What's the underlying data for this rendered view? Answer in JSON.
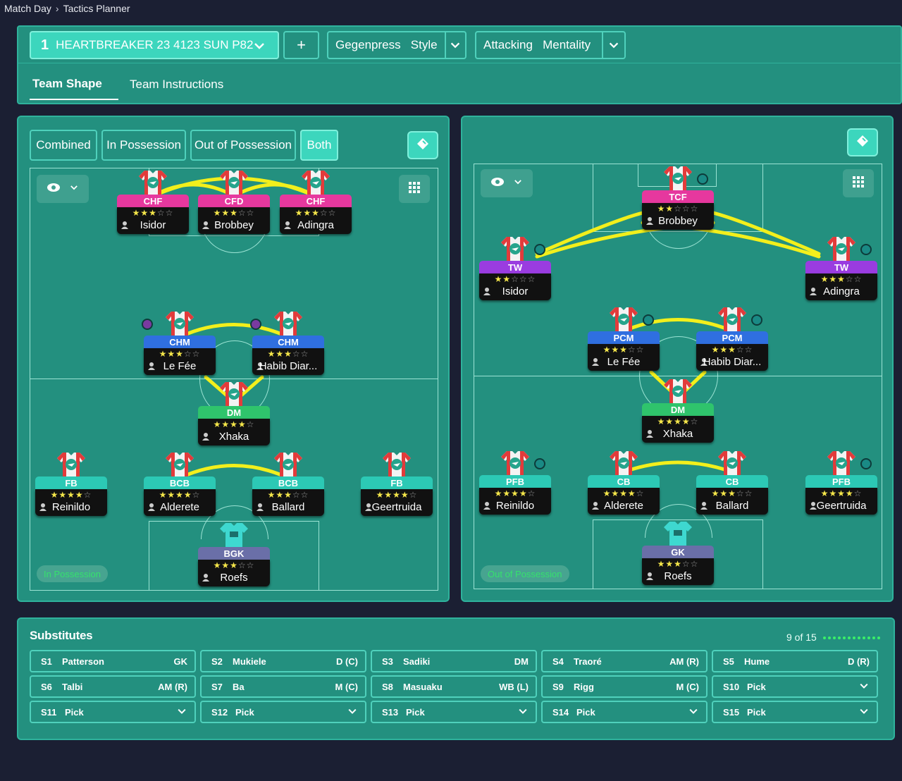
{
  "breadcrumb": {
    "root": "Match Day",
    "current": "Tactics Planner"
  },
  "tactic": {
    "number": "1",
    "name": "HEARTBREAKER 23 4123 SUN P82"
  },
  "style": {
    "value": "Gegenpress",
    "label": "Style"
  },
  "mentality": {
    "value": "Attacking",
    "label": "Mentality"
  },
  "tabs": [
    "Team Shape",
    "Team Instructions"
  ],
  "phase_filters": [
    "Combined",
    "In Possession",
    "Out of Possession",
    "Both"
  ],
  "left_pitch": {
    "label": "In Possession",
    "players": [
      {
        "role": "CHF",
        "name": "Isidor",
        "stars": 2.5,
        "color": "#e6389e"
      },
      {
        "role": "CFD",
        "name": "Brobbey",
        "stars": 2.5,
        "color": "#e6389e"
      },
      {
        "role": "CHF",
        "name": "Adingra",
        "stars": 3,
        "color": "#e6389e"
      },
      {
        "role": "CHM",
        "name": "Le Fée",
        "stars": 3,
        "color": "#2f6fe0"
      },
      {
        "role": "CHM",
        "name": "Habib Diar...",
        "stars": 2.5,
        "color": "#2f6fe0"
      },
      {
        "role": "DM",
        "name": "Xhaka",
        "stars": 4,
        "color": "#2fc46c"
      },
      {
        "role": "FB",
        "name": "Reinildo",
        "stars": 3.5,
        "color": "#2cc9b5"
      },
      {
        "role": "BCB",
        "name": "Alderete",
        "stars": 3.5,
        "color": "#2cc9b5"
      },
      {
        "role": "BCB",
        "name": "Ballard",
        "stars": 3,
        "color": "#2cc9b5"
      },
      {
        "role": "FB",
        "name": "Geertruida",
        "stars": 3.5,
        "color": "#2cc9b5"
      },
      {
        "role": "BGK",
        "name": "Roefs",
        "stars": 2.5,
        "color": "#6a6fa8"
      }
    ]
  },
  "right_pitch": {
    "label": "Out of Possession",
    "players": [
      {
        "role": "TCF",
        "name": "Brobbey",
        "stars": 2,
        "color": "#e6389e"
      },
      {
        "role": "TW",
        "name": "Isidor",
        "stars": 2,
        "color": "#9a3ce0"
      },
      {
        "role": "TW",
        "name": "Adingra",
        "stars": 2.5,
        "color": "#9a3ce0"
      },
      {
        "role": "PCM",
        "name": "Le Fée",
        "stars": 2.5,
        "color": "#2f6fe0"
      },
      {
        "role": "PCM",
        "name": "Habib Diar...",
        "stars": 2.5,
        "color": "#2f6fe0"
      },
      {
        "role": "DM",
        "name": "Xhaka",
        "stars": 4,
        "color": "#2fc46c"
      },
      {
        "role": "PFB",
        "name": "Reinildo",
        "stars": 3.5,
        "color": "#2cc9b5"
      },
      {
        "role": "CB",
        "name": "Alderete",
        "stars": 3.5,
        "color": "#2cc9b5"
      },
      {
        "role": "CB",
        "name": "Ballard",
        "stars": 3,
        "color": "#2cc9b5"
      },
      {
        "role": "PFB",
        "name": "Geertruida",
        "stars": 3.5,
        "color": "#2cc9b5"
      },
      {
        "role": "GK",
        "name": "Roefs",
        "stars": 2.5,
        "color": "#6a6fa8"
      }
    ]
  },
  "substitutes": {
    "title": "Substitutes",
    "count": "9 of 15",
    "slots": [
      {
        "slot": "S1",
        "name": "Patterson",
        "pos": "GK"
      },
      {
        "slot": "S2",
        "name": "Mukiele",
        "pos": "D (C)"
      },
      {
        "slot": "S3",
        "name": "Sadiki",
        "pos": "DM"
      },
      {
        "slot": "S4",
        "name": "Traoré",
        "pos": "AM (R)"
      },
      {
        "slot": "S5",
        "name": "Hume",
        "pos": "D (R)"
      },
      {
        "slot": "S6",
        "name": "Talbi",
        "pos": "AM (R)"
      },
      {
        "slot": "S7",
        "name": "Ba",
        "pos": "M (C)"
      },
      {
        "slot": "S8",
        "name": "Masuaku",
        "pos": "WB (L)"
      },
      {
        "slot": "S9",
        "name": "Rigg",
        "pos": "M (C)"
      },
      {
        "slot": "S10",
        "name": "Pick",
        "pos": ""
      },
      {
        "slot": "S11",
        "name": "Pick",
        "pos": ""
      },
      {
        "slot": "S12",
        "name": "Pick",
        "pos": ""
      },
      {
        "slot": "S13",
        "name": "Pick",
        "pos": ""
      },
      {
        "slot": "S14",
        "name": "Pick",
        "pos": ""
      },
      {
        "slot": "S15",
        "name": "Pick",
        "pos": ""
      }
    ]
  },
  "colors": {
    "panel": "#23907f",
    "accent": "#3cd6bd",
    "link_line": "#f2ef1c",
    "background": "#1b1f33"
  },
  "icons": [
    "chevron-right-icon",
    "chevron-down-icon",
    "plus-icon",
    "eraser-icon",
    "eye-icon",
    "grid-icon",
    "shirt-icon",
    "person-icon"
  ]
}
